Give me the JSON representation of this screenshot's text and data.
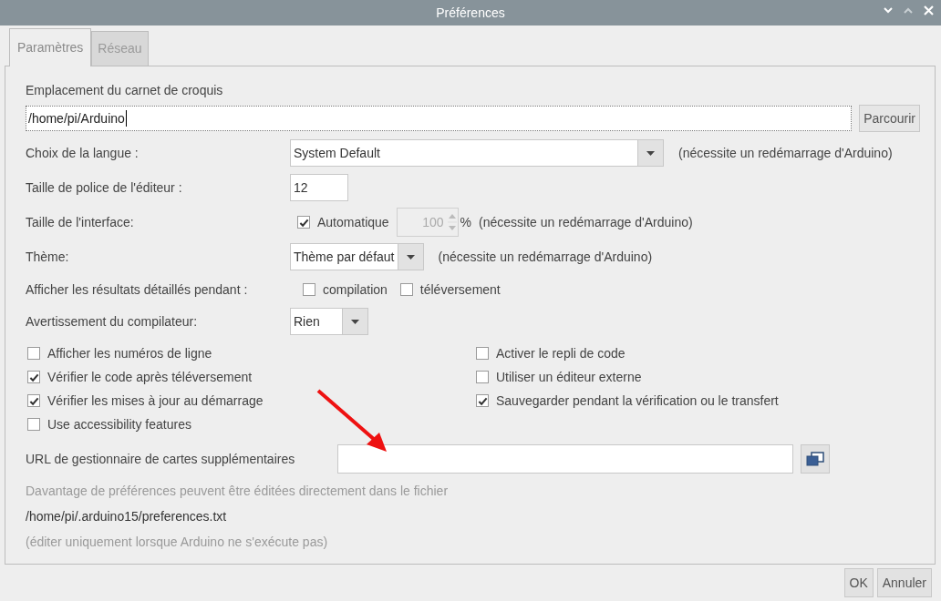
{
  "window": {
    "title": "Préférences"
  },
  "tabs": [
    {
      "label": "Paramètres",
      "selected": true
    },
    {
      "label": "Réseau",
      "selected": false
    }
  ],
  "sketchbook": {
    "label": "Emplacement du carnet de croquis",
    "value": "/home/pi/Arduino",
    "button": "Parcourir"
  },
  "language": {
    "label": "Choix de la langue :",
    "value": "System Default",
    "note": "(nécessite un redémarrage d'Arduino)"
  },
  "font_size": {
    "label": "Taille de police de l'éditeur :",
    "value": "12"
  },
  "interface_scale": {
    "label": "Taille de l'interface:",
    "auto_label": "Automatique",
    "auto_checked": true,
    "value": "100",
    "unit": "%",
    "note": "(nécessite un redémarrage d'Arduino)"
  },
  "theme": {
    "label": "Thème:",
    "value": "Thème par défaut",
    "note": "(nécessite un redémarrage d'Arduino)"
  },
  "verbose": {
    "label": "Afficher les résultats détaillés pendant :",
    "options": [
      {
        "label": "compilation",
        "checked": false
      },
      {
        "label": "téléversement",
        "checked": false
      }
    ]
  },
  "warnings": {
    "label": "Avertissement du compilateur:",
    "value": "Rien"
  },
  "options_left": [
    {
      "label": "Afficher les numéros de ligne",
      "checked": false
    },
    {
      "label": "Vérifier le code après téléversement",
      "checked": true
    },
    {
      "label": "Vérifier les mises à jour au démarrage",
      "checked": true
    },
    {
      "label": "Use accessibility features",
      "checked": false
    }
  ],
  "options_right": [
    {
      "label": "Activer le repli de code",
      "checked": false
    },
    {
      "label": "Utiliser un éditeur externe",
      "checked": false
    },
    {
      "label": "Sauvegarder pendant la vérification ou le transfert",
      "checked": true
    }
  ],
  "boards_url": {
    "label": "URL de gestionnaire de cartes supplémentaires"
  },
  "footer_notes": [
    {
      "text": "Davantage de préférences peuvent être éditées directement dans le fichier",
      "kind": "muted"
    },
    {
      "text": "/home/pi/.arduino15/preferences.txt",
      "kind": "path"
    },
    {
      "text": "(éditer uniquement lorsque Arduino ne s'exécute pas)",
      "kind": "muted"
    }
  ],
  "buttons": [
    "OK",
    "Annuler"
  ]
}
